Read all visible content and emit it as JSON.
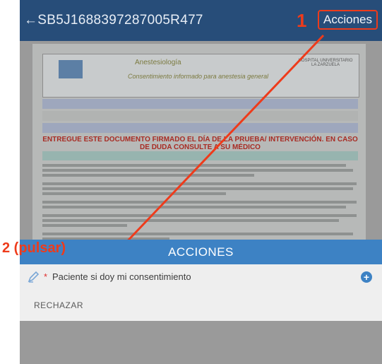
{
  "header": {
    "title": "←SB5J1688397287005R477",
    "actions_label": "Acciones"
  },
  "annotations": {
    "step1": "1",
    "step2": "2 (pulsar)"
  },
  "sheet": {
    "title": "ACCIONES",
    "option_label": "Paciente si doy mi consentimiento",
    "required_mark": "*",
    "reject_label": "RECHAZAR"
  },
  "document": {
    "department": "Anestesiología",
    "form_title": "Consentimiento informado para anestesia general",
    "hospital": "HOSPITAL UNIVERSITARIO LA ZARZUELA",
    "warning": "ENTREGUE ESTE DOCUMENTO FIRMADO EL DÍA DE LA PRUEBA/ INTERVENCIÓN. EN CASO DE DUDA CONSULTE A SU MÉDICO",
    "section": "Explicación sencilla del objetivo del procedimiento, en qué consiste y la forma en que se lleva a cabo."
  },
  "colors": {
    "topbar": "#274d79",
    "sheet_header": "#3d82c4",
    "annotation": "#ee3b1b"
  }
}
